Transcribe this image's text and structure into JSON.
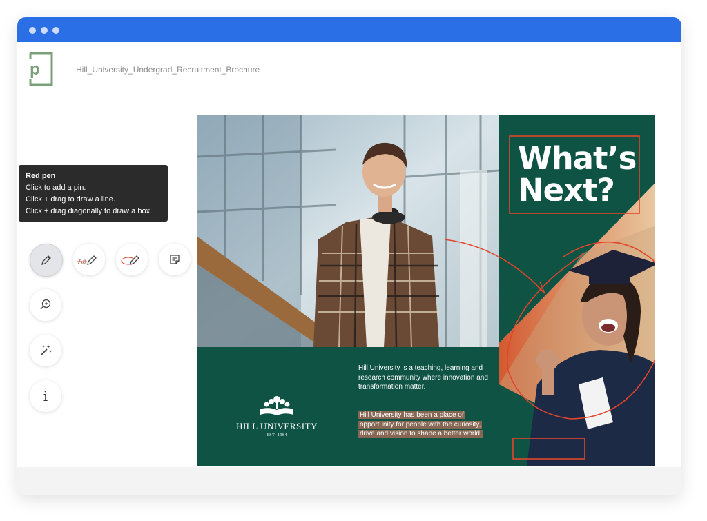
{
  "app": {
    "logo_letter": "p",
    "document_title": "Hill_University_Undergrad_Recruitment_Brochure"
  },
  "tooltip": {
    "title": "Red pen",
    "lines": [
      "Click to add a pin.",
      "Click + drag to draw a line.",
      "Click + drag diagonally to draw a box."
    ]
  },
  "toolbar": {
    "tools": [
      {
        "icon": "pen-icon",
        "active": true
      },
      {
        "icon": "text-strikethrough-pen-icon",
        "label": "Aa"
      },
      {
        "icon": "circle-pen-icon"
      },
      {
        "icon": "note-icon"
      },
      {
        "icon": "zoom-in-icon"
      },
      {
        "icon": "magic-wand-icon"
      },
      {
        "icon": "info-icon",
        "label": "i"
      }
    ]
  },
  "brochure": {
    "headline_line1": "What’s",
    "headline_line2": "Next?",
    "university_name": "HILL UNIVERSITY",
    "university_est": "EST. 1984",
    "paragraph1": "Hill University is a teaching, learning and research community where innovation and transformation matter.",
    "paragraph2": "Hill University has been a place of opportunity for people with the curiosity, drive and vision to shape a better world."
  },
  "colors": {
    "titlebar": "#2b6fe6",
    "brand_green": "#0f5345",
    "annotation_red": "#e2452b",
    "highlight": "#b06e58",
    "logo_green": "#7aa07a"
  }
}
